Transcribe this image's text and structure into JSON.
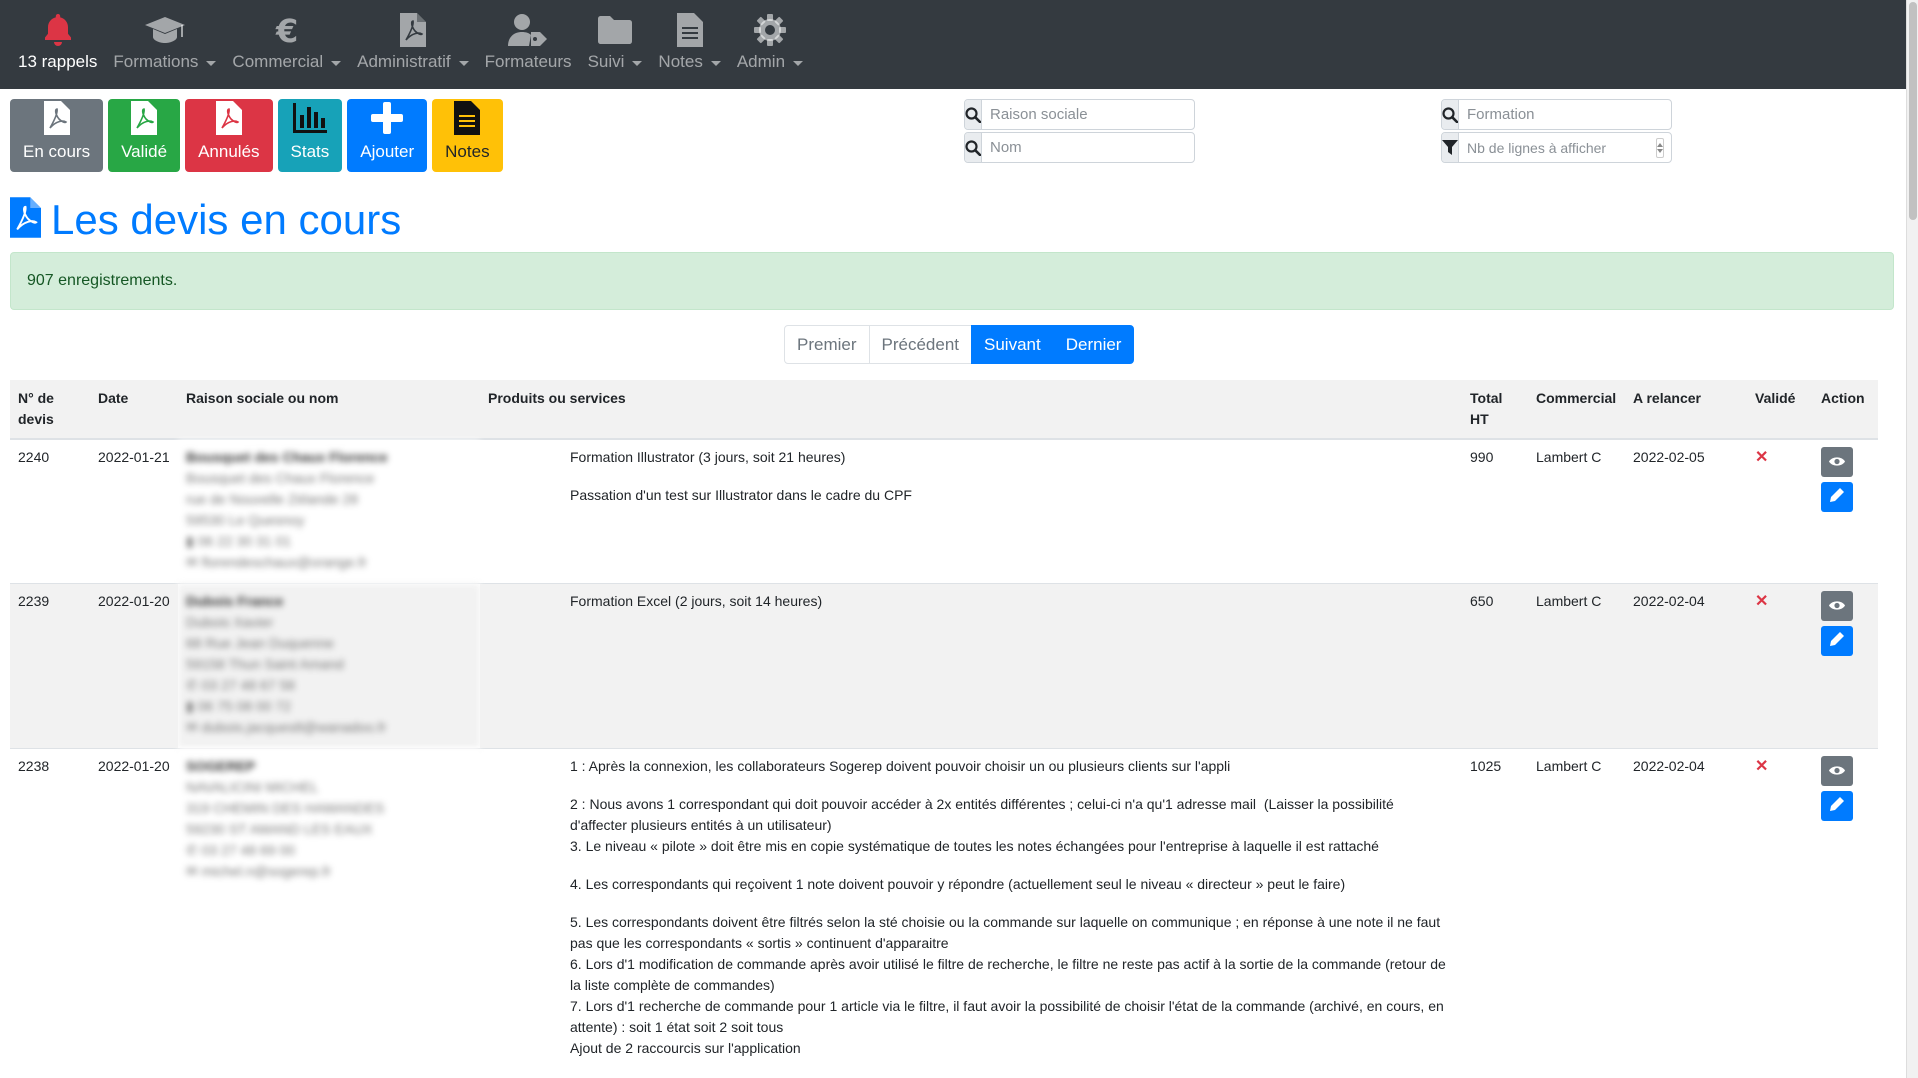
{
  "navbar": {
    "items": [
      {
        "label": "13 rappels",
        "icon": "bell-icon",
        "dropdown": false
      },
      {
        "label": "Formations",
        "icon": "graduation-cap-icon",
        "dropdown": true
      },
      {
        "label": "Commercial",
        "icon": "euro-icon",
        "dropdown": true
      },
      {
        "label": "Administratif",
        "icon": "pdf-file-icon",
        "dropdown": true
      },
      {
        "label": "Formateurs",
        "icon": "user-tag-icon",
        "dropdown": false
      },
      {
        "label": "Suivi",
        "icon": "folder-icon",
        "dropdown": true
      },
      {
        "label": "Notes",
        "icon": "document-icon",
        "dropdown": true
      },
      {
        "label": "Admin",
        "icon": "gear-icon",
        "dropdown": true
      }
    ],
    "bell_color": "#dc3545"
  },
  "toolbar": {
    "buttons": [
      {
        "label": "En cours",
        "icon": "pdf-file-icon",
        "color": "#6c757d"
      },
      {
        "label": "Validé",
        "icon": "pdf-file-icon",
        "color": "#28a745"
      },
      {
        "label": "Annulés",
        "icon": "pdf-file-icon",
        "color": "#dc3545"
      },
      {
        "label": "Stats",
        "icon": "bar-chart-icon",
        "color": "#17a2b8"
      },
      {
        "label": "Ajouter",
        "icon": "plus-icon",
        "color": "#007bff"
      },
      {
        "label": "Notes",
        "icon": "document-icon",
        "color": "#ffc107"
      }
    ]
  },
  "search": {
    "raison_sociale_placeholder": "Raison sociale",
    "nom_placeholder": "Nom",
    "formation_placeholder": "Formation",
    "nb_lignes_placeholder": "Nb de lignes à afficher"
  },
  "page": {
    "title": "Les devis en cours",
    "alert": "907 enregistrements."
  },
  "pagination": {
    "first": "Premier",
    "prev": "Précédent",
    "next": "Suivant",
    "last": "Dernier"
  },
  "table": {
    "headers": {
      "num_line1": "N° de",
      "num_line2": "devis",
      "date": "Date",
      "raison": "Raison sociale ou nom",
      "produits": "Produits ou services",
      "total_line1": "Total",
      "total_line2": "HT",
      "commercial": "Commercial",
      "relancer": "A relancer",
      "valide": "Validé",
      "action": "Action"
    },
    "invalid_mark": "✕",
    "rows": [
      {
        "num": "2240",
        "date": "2022-01-21",
        "client": [
          "Bousquet des Chaux Florence",
          "Bousquet des Chaux Florence",
          "rue de Nouvelle Zélande 28",
          "59530 Le Quesnoy",
          "06 22 30 31 01",
          "florendeschaux@orange.fr"
        ],
        "produits": [
          {
            "text": "Formation Illustrator (3 jours, soit 21 heures)",
            "gap": false
          },
          {
            "text": "Passation d'un test sur Illustrator dans le cadre du CPF",
            "gap": true
          }
        ],
        "total": "990",
        "commercial": "Lambert C",
        "relancer": "2022-02-05"
      },
      {
        "num": "2239",
        "date": "2022-01-20",
        "client": [
          "Dubois France",
          "Dubois Xavier",
          "68 Rue Jean Duquenne",
          "59158 Thun Saint Amand",
          "03 27 48 67 58",
          "06 75 08 00 72",
          "dubois.jacques8@wanadoo.fr"
        ],
        "produits": [
          {
            "text": "Formation Excel (2 jours, soit 14 heures)",
            "gap": false
          }
        ],
        "total": "650",
        "commercial": "Lambert C",
        "relancer": "2022-02-04"
      },
      {
        "num": "2238",
        "date": "2022-01-20",
        "client": [
          "SOGEREP",
          "NAVALICINI MICHEL",
          "319 CHEMIN DES HAMANDES",
          "59230 ST AMAND LES EAUX",
          "03 27 48 69 00",
          "michel.n@sogerep.fr"
        ],
        "produits": [
          {
            "text": "1 : Après la connexion, les collaborateurs Sogerep doivent pouvoir choisir un ou plusieurs clients sur l'appli",
            "gap": false
          },
          {
            "text": "2 : Nous avons 1 correspondant qui doit pouvoir accéder à 2x entités différentes ; celui-ci n'a qu'1 adresse mail  (Laisser la possibilité d'affecter plusieurs entités à un utilisateur)",
            "gap": true
          },
          {
            "text": "3. Le niveau « pilote » doit être mis en copie systématique de toutes les notes échangées pour l'entreprise à laquelle il est rattaché",
            "gap": false
          },
          {
            "text": "4. Les correspondants qui reçoivent 1 note doivent pouvoir y répondre (actuellement seul le niveau « directeur » peut le faire)",
            "gap": true
          },
          {
            "text": "5. Les correspondants doivent être filtrés selon la sté choisie ou la commande sur laquelle on communique ; en réponse à une note il ne faut pas que les correspondants « sortis » continuent d'apparaitre",
            "gap": true
          },
          {
            "text": "6. Lors d'1 modification de commande après avoir utilisé le filtre de recherche, le filtre ne reste pas actif à la sortie de la commande (retour de la liste complète de commandes)",
            "gap": false
          },
          {
            "text": "7. Lors d'1 recherche de commande pour 1 article via le filtre, il faut avoir la possibilité de choisir l'état de la commande (archivé, en cours, en attente) : soit 1 état soit 2 soit tous",
            "gap": false
          },
          {
            "text": "Ajout de 2 raccourcis sur l'application",
            "gap": false
          }
        ],
        "total": "1025",
        "commercial": "Lambert C",
        "relancer": "2022-02-04"
      }
    ]
  }
}
